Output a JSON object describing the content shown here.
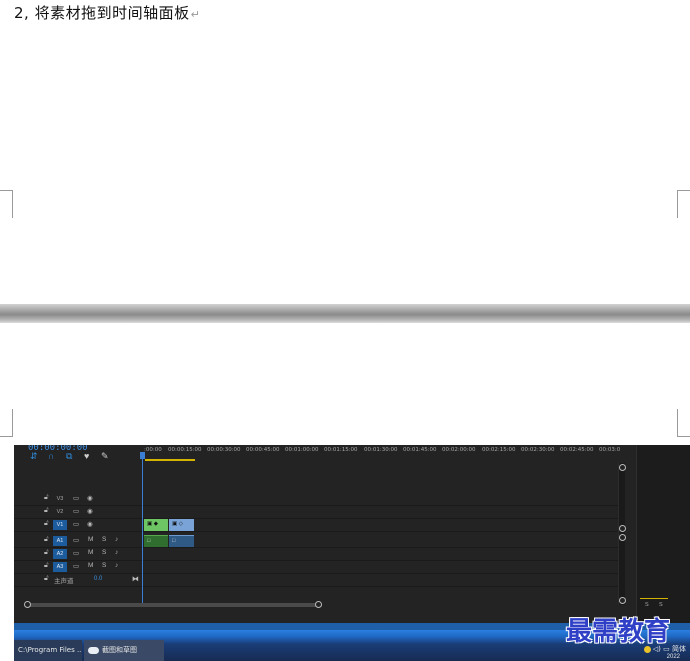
{
  "document": {
    "step_heading": "2, 将素材拖到时间轴面板",
    "para_mark": "↵"
  },
  "timeline": {
    "timecode": "00:00:00:00",
    "tool_icons": [
      "snap-icon",
      "magnet-icon",
      "linked-selection-icon",
      "marker-icon",
      "wrench-icon"
    ],
    "ruler_labels": [
      ":00:00",
      "00:00:15:00",
      "00:00:30:00",
      "00:00:45:00",
      "00:01:00:00",
      "00:01:15:00",
      "00:01:30:00",
      "00:01:45:00",
      "00:02:00:00",
      "00:02:15:00",
      "00:02:30:00",
      "00:02:45:00",
      "00:03:0"
    ],
    "video_tracks": [
      {
        "name": "V3",
        "active": false
      },
      {
        "name": "V2",
        "active": false
      },
      {
        "name": "V1",
        "active": true
      }
    ],
    "audio_tracks": [
      {
        "name": "A1",
        "m": "M",
        "s": "S"
      },
      {
        "name": "A2",
        "m": "M",
        "s": "S"
      },
      {
        "name": "A3",
        "m": "M",
        "s": "S"
      }
    ],
    "master_label": "主声道",
    "master_value": "0.0",
    "meter_labels": [
      "S",
      "S"
    ],
    "colors": {
      "playhead": "#3b7fd4",
      "video_clip_1": "#6ec564",
      "video_clip_2": "#7aa3d8",
      "in_out_bar": "#d4b400"
    }
  },
  "taskbar": {
    "item_1": "C:\\Program Files ...",
    "item_2": "截图和草图",
    "tray_lang": "简体",
    "year": "2022"
  },
  "watermark": "最需教育"
}
